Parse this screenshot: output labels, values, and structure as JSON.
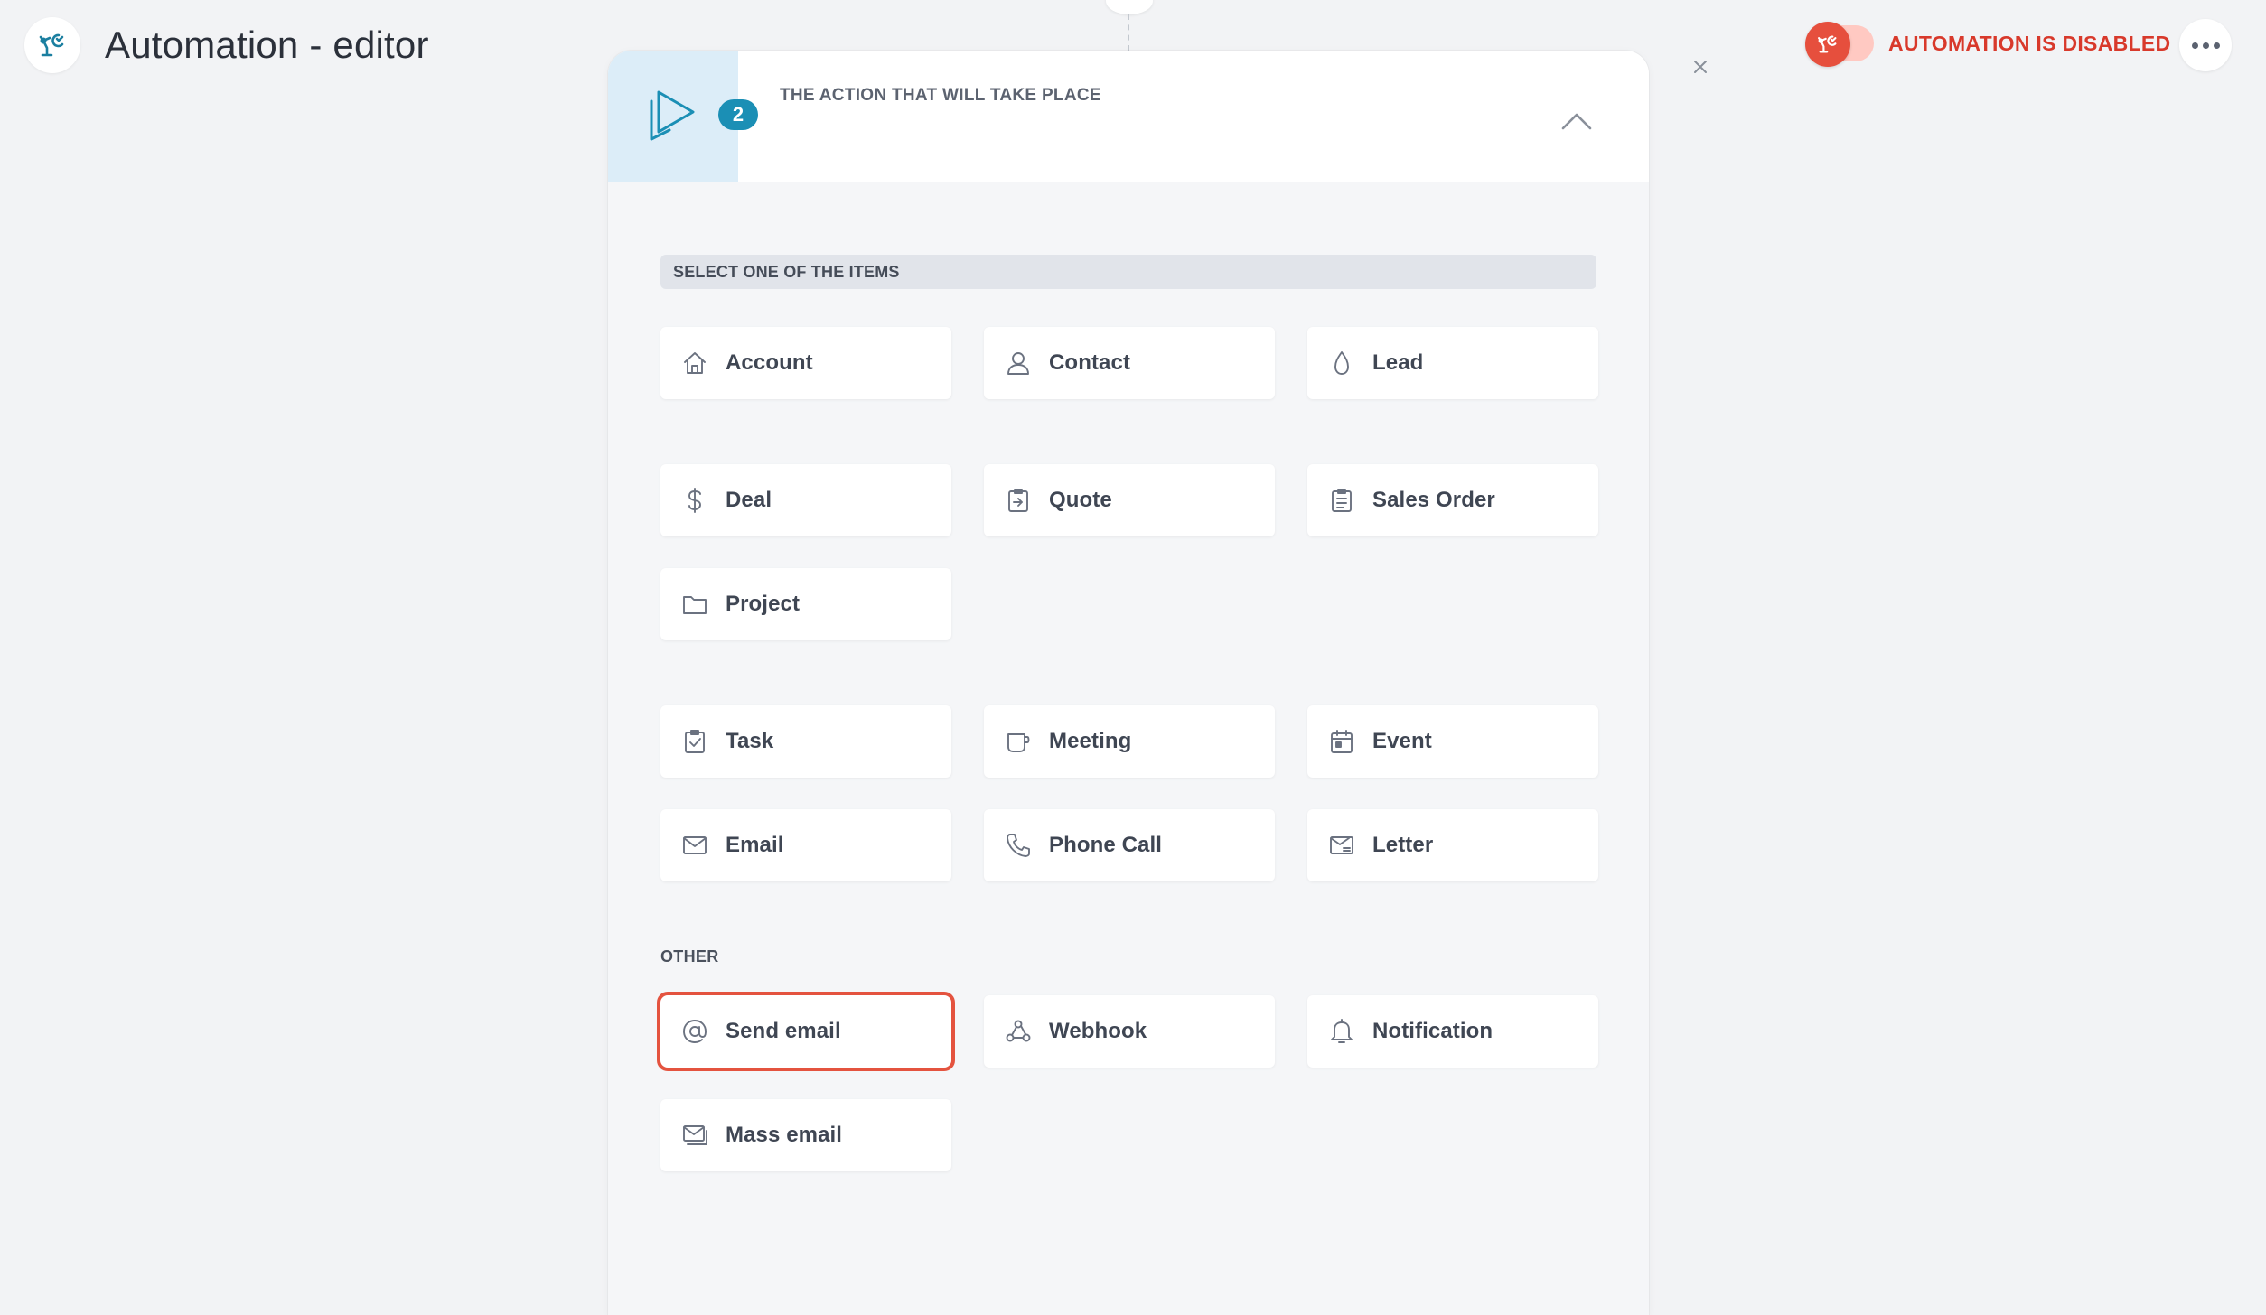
{
  "header": {
    "title": "Automation - editor",
    "status_label": "AUTOMATION IS DISABLED",
    "status_enabled": false
  },
  "colors": {
    "accent": "#1b8fb5",
    "danger": "#d8392b",
    "selected_outline": "#e4533f",
    "icon_column": "#dcedf8"
  },
  "panel": {
    "step_number": "2",
    "title": "THE ACTION THAT WILL TAKE PLACE",
    "section_label": "SELECT ONE OF THE ITEMS",
    "other_label": "OTHER",
    "items": {
      "account": {
        "label": "Account",
        "icon": "home-icon"
      },
      "contact": {
        "label": "Contact",
        "icon": "person-icon"
      },
      "lead": {
        "label": "Lead",
        "icon": "drop-icon"
      },
      "deal": {
        "label": "Deal",
        "icon": "dollar-icon"
      },
      "quote": {
        "label": "Quote",
        "icon": "clipboard-arrow-icon"
      },
      "sales_order": {
        "label": "Sales Order",
        "icon": "clipboard-list-icon"
      },
      "project": {
        "label": "Project",
        "icon": "folder-icon"
      },
      "task": {
        "label": "Task",
        "icon": "clipboard-check-icon"
      },
      "meeting": {
        "label": "Meeting",
        "icon": "cup-icon"
      },
      "event": {
        "label": "Event",
        "icon": "calendar-icon"
      },
      "email": {
        "label": "Email",
        "icon": "envelope-icon"
      },
      "phone_call": {
        "label": "Phone Call",
        "icon": "phone-icon"
      },
      "letter": {
        "label": "Letter",
        "icon": "letter-icon"
      },
      "send_email": {
        "label": "Send email",
        "icon": "at-icon",
        "selected": true
      },
      "webhook": {
        "label": "Webhook",
        "icon": "webhook-icon"
      },
      "notification": {
        "label": "Notification",
        "icon": "bell-icon"
      },
      "mass_email": {
        "label": "Mass email",
        "icon": "mass-mail-icon"
      }
    }
  }
}
